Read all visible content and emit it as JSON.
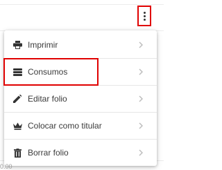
{
  "menu": {
    "items": [
      {
        "label": "Imprimir",
        "icon": "printer-icon"
      },
      {
        "label": "Consumos",
        "icon": "stack-icon"
      },
      {
        "label": "Editar folio",
        "icon": "pencil-icon"
      },
      {
        "label": "Colocar como titular",
        "icon": "crown-icon"
      },
      {
        "label": "Borrar folio",
        "icon": "trash-icon"
      }
    ]
  },
  "background": {
    "partial_value": "0.00"
  },
  "colors": {
    "highlight": "#e00000",
    "text": "#3a3a3a",
    "icon": "#333333",
    "chevron": "#bdbdbd"
  }
}
